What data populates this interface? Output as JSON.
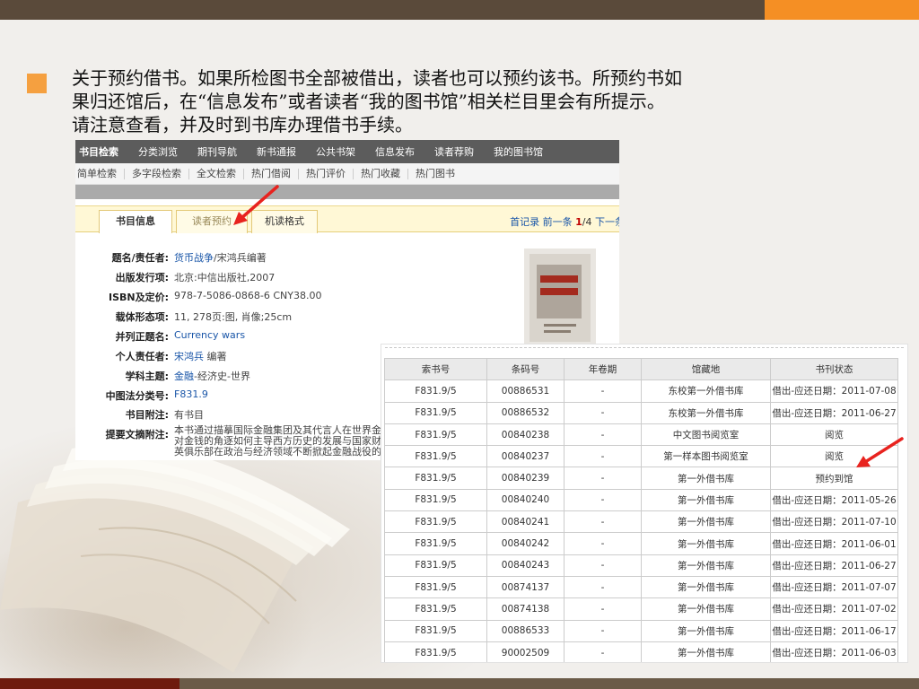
{
  "slide": {
    "text_lines": [
      "关于预约借书。如果所检图书全部被借出，读者也可以预约该书。所预约书如",
      "果归还馆后，在“信息发布”或者读者“我的图书馆”相关栏目里会有所提示。",
      "请注意查看，并及时到书库办理借书手续。"
    ]
  },
  "catalog_page": {
    "nav": [
      "书目检索",
      "分类浏览",
      "期刊导航",
      "新书通报",
      "公共书架",
      "信息发布",
      "读者荐购",
      "我的图书馆"
    ],
    "subnav": [
      "简单检索",
      "多字段检索",
      "全文检索",
      "热门借阅",
      "热门评价",
      "热门收藏",
      "热门图书"
    ],
    "tabs": [
      "书目信息",
      "读者预约",
      "机读格式"
    ],
    "pager": {
      "first": "首记录",
      "prev": "前一条",
      "current": "1",
      "sep": "/",
      "total": "4",
      "next": "下一条"
    },
    "fields": [
      {
        "label": "题名/责任者:",
        "value_link": "货币战争",
        "value": "/宋鸿兵编著"
      },
      {
        "label": "出版发行项:",
        "value_link": "",
        "value": "北京:中信出版社,2007"
      },
      {
        "label": "ISBN及定价:",
        "value_link": "",
        "value": "978-7-5086-0868-6 CNY38.00"
      },
      {
        "label": "载体形态项:",
        "value_link": "",
        "value": "11, 278页:图, 肖像;25cm"
      },
      {
        "label": "并列正题名:",
        "value_link": "Currency wars",
        "value": ""
      },
      {
        "label": "个人责任者:",
        "value_link": "宋鸿兵",
        "value": " 编著"
      },
      {
        "label": "学科主题:",
        "value_link": "金融",
        "value": "-经济史-世界"
      },
      {
        "label": "中图法分类号:",
        "value_link": "F831.9",
        "value": ""
      },
      {
        "label": "书目附注:",
        "value_link": "",
        "value": "有书目"
      },
      {
        "label": "提要文摘附注:",
        "value_link": "",
        "value": ""
      }
    ],
    "abstract_lines": [
      "本书通过描摹国际金融集团及其代言人在世界金",
      "对金钱的角逐如何主导西方历史的发展与国家财",
      "英俱乐部在政治与经济领域不断掀起金融战役的"
    ],
    "cover_title": "货币战争"
  },
  "holdings": {
    "headers": [
      "索书号",
      "条码号",
      "年卷期",
      "馆藏地",
      "书刊状态"
    ],
    "rows": [
      [
        "F831.9/5",
        "00886531",
        "-",
        "东校第一外借书库",
        "借出-应还日期：2011-07-08"
      ],
      [
        "F831.9/5",
        "00886532",
        "-",
        "东校第一外借书库",
        "借出-应还日期：2011-06-27"
      ],
      [
        "F831.9/5",
        "00840238",
        "-",
        "中文图书阅览室",
        "阅览"
      ],
      [
        "F831.9/5",
        "00840237",
        "-",
        "第一样本图书阅览室",
        "阅览"
      ],
      [
        "F831.9/5",
        "00840239",
        "-",
        "第一外借书库",
        "预约到馆"
      ],
      [
        "F831.9/5",
        "00840240",
        "-",
        "第一外借书库",
        "借出-应还日期：2011-05-26"
      ],
      [
        "F831.9/5",
        "00840241",
        "-",
        "第一外借书库",
        "借出-应还日期：2011-07-10"
      ],
      [
        "F831.9/5",
        "00840242",
        "-",
        "第一外借书库",
        "借出-应还日期：2011-06-01"
      ],
      [
        "F831.9/5",
        "00840243",
        "-",
        "第一外借书库",
        "借出-应还日期：2011-06-27"
      ],
      [
        "F831.9/5",
        "00874137",
        "-",
        "第一外借书库",
        "借出-应还日期：2011-07-07"
      ],
      [
        "F831.9/5",
        "00874138",
        "-",
        "第一外借书库",
        "借出-应还日期：2011-07-02"
      ],
      [
        "F831.9/5",
        "00886533",
        "-",
        "第一外借书库",
        "借出-应还日期：2011-06-17"
      ],
      [
        "F831.9/5",
        "90002509",
        "-",
        "第一外借书库",
        "借出-应还日期：2011-06-03"
      ]
    ]
  },
  "colors": {
    "top_bar": "#5a4a3a",
    "top_accent": "#f58f24",
    "bullet": "#f5a040",
    "bottom_accent": "#6e1b0e",
    "arrow": "#e8231f",
    "link": "#1a56a8"
  },
  "icons": {
    "bullet": "square-bullet-icon",
    "arrow": "red-pointer-arrow-icon"
  }
}
